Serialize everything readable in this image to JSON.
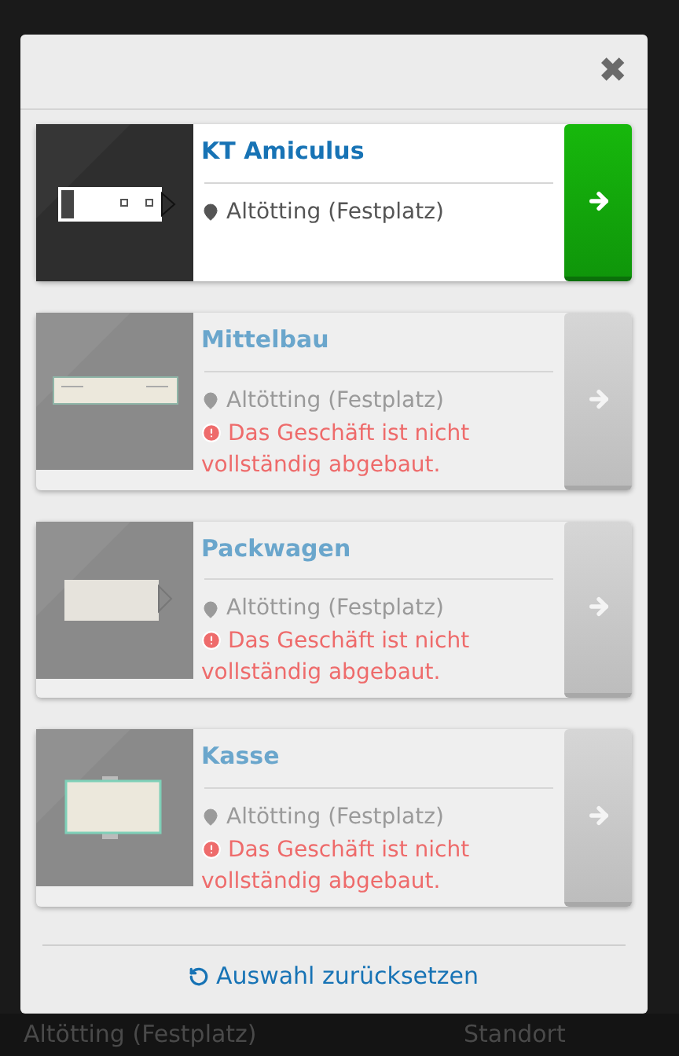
{
  "background": {
    "bottom_bar": [
      "Altötting (Festplatz)",
      "Standort"
    ]
  },
  "dialog": {
    "close": "✖",
    "items": [
      {
        "name": "KT Amiculus",
        "location": "Altötting (Festplatz)",
        "available": true
      },
      {
        "name": "Mittelbau",
        "location": "Altötting (Festplatz)",
        "available": false,
        "error": "Das Geschäft ist nicht vollständig abgebaut."
      },
      {
        "name": "Packwagen",
        "location": "Altötting (Festplatz)",
        "available": false,
        "error": "Das Geschäft ist nicht vollständig abgebaut."
      },
      {
        "name": "Kasse",
        "location": "Altötting (Festplatz)",
        "available": false,
        "error": "Das Geschäft ist nicht vollständig abgebaut."
      }
    ],
    "reset": "Auswahl zurücksetzen"
  }
}
